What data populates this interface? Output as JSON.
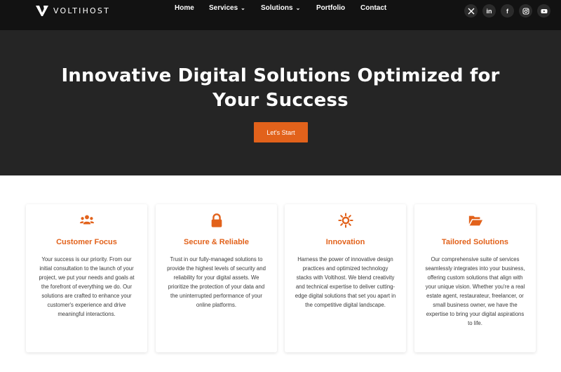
{
  "brand": {
    "name": "VOLTIHOST"
  },
  "nav": {
    "items": [
      {
        "label": "Home",
        "active": true,
        "has_dropdown": false
      },
      {
        "label": "Services",
        "active": false,
        "has_dropdown": true
      },
      {
        "label": "Solutions",
        "active": false,
        "has_dropdown": true
      },
      {
        "label": "Portfolio",
        "active": false,
        "has_dropdown": false
      },
      {
        "label": "Contact",
        "active": false,
        "has_dropdown": false
      }
    ],
    "dropdown_glyph": "⌄"
  },
  "socials": [
    {
      "icon": "x-icon",
      "glyph": "X"
    },
    {
      "icon": "linkedin-icon",
      "glyph": "in"
    },
    {
      "icon": "facebook-icon",
      "glyph": "f"
    },
    {
      "icon": "instagram-icon",
      "glyph": ""
    },
    {
      "icon": "youtube-icon",
      "glyph": ""
    }
  ],
  "hero": {
    "title": "Innovative Digital Solutions Optimized for Your Success",
    "cta_label": "Let's Start"
  },
  "cards": [
    {
      "icon": "users-icon",
      "title": "Customer Focus",
      "body": "Your success is our priority. From our initial consultation to the launch of your project, we put your needs and goals at the forefront of everything we do. Our solutions are crafted to enhance your customer's experience and drive meaningful interactions."
    },
    {
      "icon": "lock-icon",
      "title": "Secure & Reliable",
      "body": "Trust in our fully-managed solutions to provide the highest levels of security and reliability for your digital assets. We prioritize the protection of your data and the uninterrupted performance of your online platforms."
    },
    {
      "icon": "sun-icon",
      "title": "Innovation",
      "body": "Harness the power of innovative design practices and optimized technology stacks with Voltihost. We blend creativity and technical expertise to deliver cutting-edge digital solutions that set you apart in the competitive digital landscape."
    },
    {
      "icon": "folder-open-icon",
      "title": "Tailored Solutions",
      "body": "Our comprehensive suite of services seamlessly integrates into your business, offering custom solutions that align with your unique vision. Whether you're a real estate agent, restaurateur, freelancer, or small business owner, we have the expertise to bring your digital aspirations to life."
    }
  ],
  "colors": {
    "accent": "#e2621b",
    "header_bg": "#121212",
    "hero_bg": "#252525",
    "social_bg": "#2b2b2b"
  }
}
